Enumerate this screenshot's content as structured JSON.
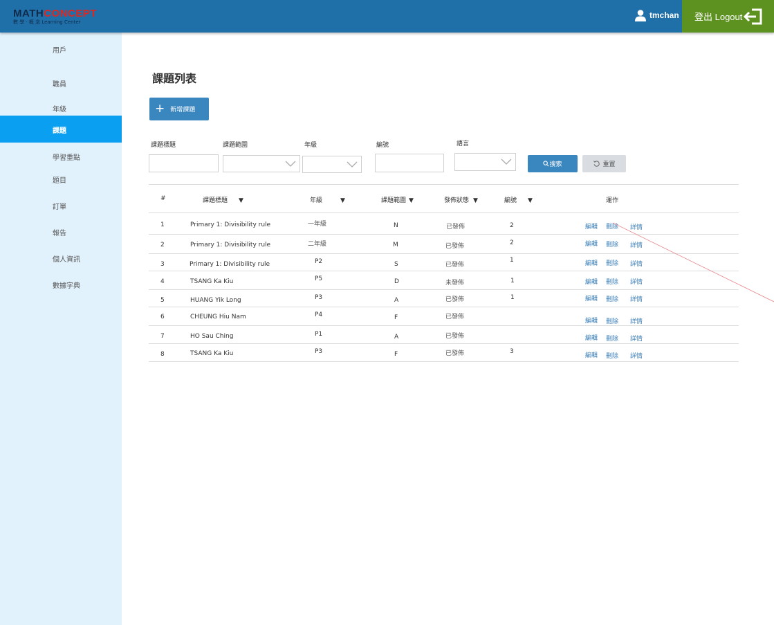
{
  "header": {
    "logo": {
      "part1": "MATH",
      "part2": "CONCEPT",
      "subtitle": "數 學 · 概 念  Learning Center"
    },
    "username": "tmchan",
    "logout_label": "登出 Logout"
  },
  "sidebar": {
    "items": [
      {
        "label": "用戶"
      },
      {
        "label": "職員"
      },
      {
        "label": "年級"
      },
      {
        "label": "課題"
      },
      {
        "label": "學習重點"
      },
      {
        "label": "題目"
      },
      {
        "label": "訂單"
      },
      {
        "label": "報告"
      },
      {
        "label": "個人資訊"
      },
      {
        "label": "數據字典"
      }
    ],
    "active_index": 3
  },
  "page": {
    "title": "課題列表",
    "add_button_label": "新增課題"
  },
  "filters": {
    "title_label": "課題標題",
    "title_value": "",
    "range_label": "課題範圍",
    "range_value": "",
    "grade_label": "年級",
    "grade_value": "",
    "code_label": "編號",
    "code_value": "",
    "language_label": "語言",
    "language_value": "",
    "search_label": "搜索",
    "reset_label": "重置"
  },
  "table": {
    "columns": [
      "#",
      "課題標題",
      "年級",
      "課題範圍",
      "發佈狀態",
      "編號",
      "運作"
    ],
    "rows": [
      {
        "num": "1",
        "title": "Primary 1: Divisibility rule",
        "grade": "一年級",
        "range": "N",
        "status": "已發佈",
        "code": "2"
      },
      {
        "num": "2",
        "title": "Primary 1: Divisibility rule",
        "grade": "二年級",
        "range": "M",
        "status": "已發佈",
        "code": "2"
      },
      {
        "num": "3",
        "title": "Primary 1: Divisibility rule",
        "grade": "P2",
        "range": "S",
        "status": "已發佈",
        "code": "1"
      },
      {
        "num": "4",
        "title": "TSANG Ka Kiu",
        "grade": "P5",
        "range": "D",
        "status": "未發佈",
        "code": "1"
      },
      {
        "num": "5",
        "title": "HUANG Yik Long",
        "grade": "P3",
        "range": "A",
        "status": "已發佈",
        "code": "1"
      },
      {
        "num": "6",
        "title": "CHEUNG Hiu Nam",
        "grade": "P4",
        "range": "F",
        "status": "已發佈",
        "code": ""
      },
      {
        "num": "7",
        "title": "HO Sau Ching",
        "grade": "P1",
        "range": "A",
        "status": "已發佈",
        "code": ""
      },
      {
        "num": "8",
        "title": "TSANG Ka Kiu",
        "grade": "P3",
        "range": "F",
        "status": "已發佈",
        "code": "3"
      }
    ],
    "actions": {
      "edit": "編輯",
      "delete": "刪除",
      "detail": "詳情"
    }
  },
  "colors": {
    "header": "#1f6fa8",
    "logout": "#5d9120",
    "sidebar": "#e2f2fd",
    "sidebar_active": "#0a9ff0",
    "primary_button": "#3a86bf",
    "link": "#3b7fb6",
    "annotation_line": "#e8868a"
  }
}
